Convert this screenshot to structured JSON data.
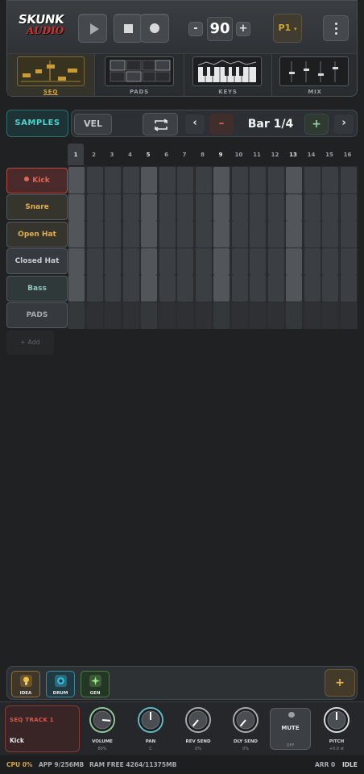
{
  "header": {
    "logo_line1": "SKUNK",
    "logo_line2": "AUDIO",
    "bpm_minus": "-",
    "bpm": "90",
    "bpm_plus": "+",
    "preset": "P1",
    "preset_arrow": "▾"
  },
  "nav": {
    "tabs": [
      {
        "label": "SEQ",
        "active": true
      },
      {
        "label": "PADS",
        "active": false
      },
      {
        "label": "KEYS",
        "active": false
      },
      {
        "label": "MIX",
        "active": false
      }
    ]
  },
  "seq": {
    "samples_label": "SAMPLES",
    "vel_label": "VEL",
    "prev": "‹",
    "bar_minus": "–",
    "bar_label": "Bar 1/4",
    "bar_plus": "+",
    "next": "›",
    "steps": [
      "1",
      "2",
      "3",
      "4",
      "5",
      "6",
      "7",
      "8",
      "9",
      "10",
      "11",
      "12",
      "13",
      "14",
      "15",
      "16"
    ],
    "current_step": 1,
    "tracks": [
      {
        "label": "Kick",
        "color": "#e06657",
        "active": true
      },
      {
        "label": "Snare",
        "color": "#e3b04a"
      },
      {
        "label": "Open Hat",
        "color": "#e3b04a"
      },
      {
        "label": "Closed Hat",
        "color": "#c9ccd0"
      },
      {
        "label": "Bass",
        "color": "#8fc7c2"
      },
      {
        "label": "PADS",
        "color": "#a5a9ae"
      }
    ],
    "add_label": "+ Add"
  },
  "modes": {
    "buttons": [
      {
        "label": "IDEA",
        "icon": "lightbulb-icon"
      },
      {
        "label": "DRUM",
        "icon": "drum-icon"
      },
      {
        "label": "GEN",
        "icon": "sparkle-icon"
      }
    ],
    "plus": "+"
  },
  "track_panel": {
    "title": "SEQ TRACK 1",
    "name": "Kick",
    "knobs": [
      {
        "label": "VOLUME",
        "value": "80%",
        "color": "#8fc79a"
      },
      {
        "label": "PAN",
        "value": "C",
        "color": "#5fb8c2"
      },
      {
        "label": "REV SEND",
        "value": "0%",
        "color": "#a5a9ae"
      },
      {
        "label": "DLY SEND",
        "value": "0%",
        "color": "#a5a9ae"
      }
    ],
    "mute_label": "MUTE",
    "mute_state": "OFF",
    "pitch": {
      "label": "PITCH",
      "value": "+0.0 st"
    }
  },
  "status": {
    "cpu": "CPU 0%",
    "app": "APP 9/256MB",
    "ram": "RAM FREE 4264/11375MB",
    "arr": "ARR 0",
    "state": "IDLE"
  }
}
